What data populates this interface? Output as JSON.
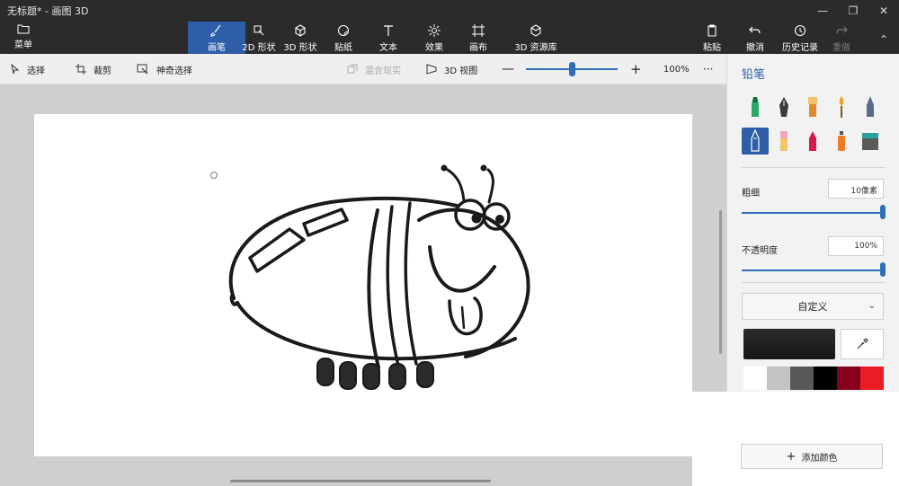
{
  "window": {
    "title": "无标题* - 画图 3D"
  },
  "menu": {
    "label": "菜单"
  },
  "tools": [
    {
      "label": "画笔",
      "icon": "brush-icon",
      "active": true
    },
    {
      "label": "2D 形状",
      "icon": "shapes-2d-icon"
    },
    {
      "label": "3D 形状",
      "icon": "cube-icon"
    },
    {
      "label": "贴纸",
      "icon": "sticker-icon"
    },
    {
      "label": "文本",
      "icon": "text-icon"
    },
    {
      "label": "效果",
      "icon": "effects-icon"
    },
    {
      "label": "画布",
      "icon": "canvas-icon"
    },
    {
      "label": "3D 资源库",
      "icon": "library-3d-icon"
    }
  ],
  "right_tools": [
    {
      "label": "粘贴",
      "icon": "paste-icon"
    },
    {
      "label": "撤消",
      "icon": "undo-icon"
    },
    {
      "label": "历史记录",
      "icon": "history-icon"
    },
    {
      "label": "重做",
      "icon": "redo-icon",
      "disabled": true
    }
  ],
  "subtoolbar": {
    "select": "选择",
    "crop": "裁剪",
    "magic_select": "神奇选择",
    "mixed_reality": "混合现实",
    "view_3d": "3D 视图",
    "zoom_value": "100%",
    "zoom_level": 0.5,
    "more": "···"
  },
  "panel": {
    "title": "铅笔",
    "thickness_label": "粗细",
    "thickness_value": "10像素",
    "opacity_label": "不透明度",
    "opacity_value": "100%",
    "dropdown_value": "自定义",
    "add_color": "添加颜色",
    "palette": [
      "#ffffff",
      "#c3c3c3",
      "#585858",
      "#000000",
      "#88001b",
      "#ec1c24"
    ],
    "current_color": "#1f1f1f",
    "accent": "#2f5ea8"
  }
}
